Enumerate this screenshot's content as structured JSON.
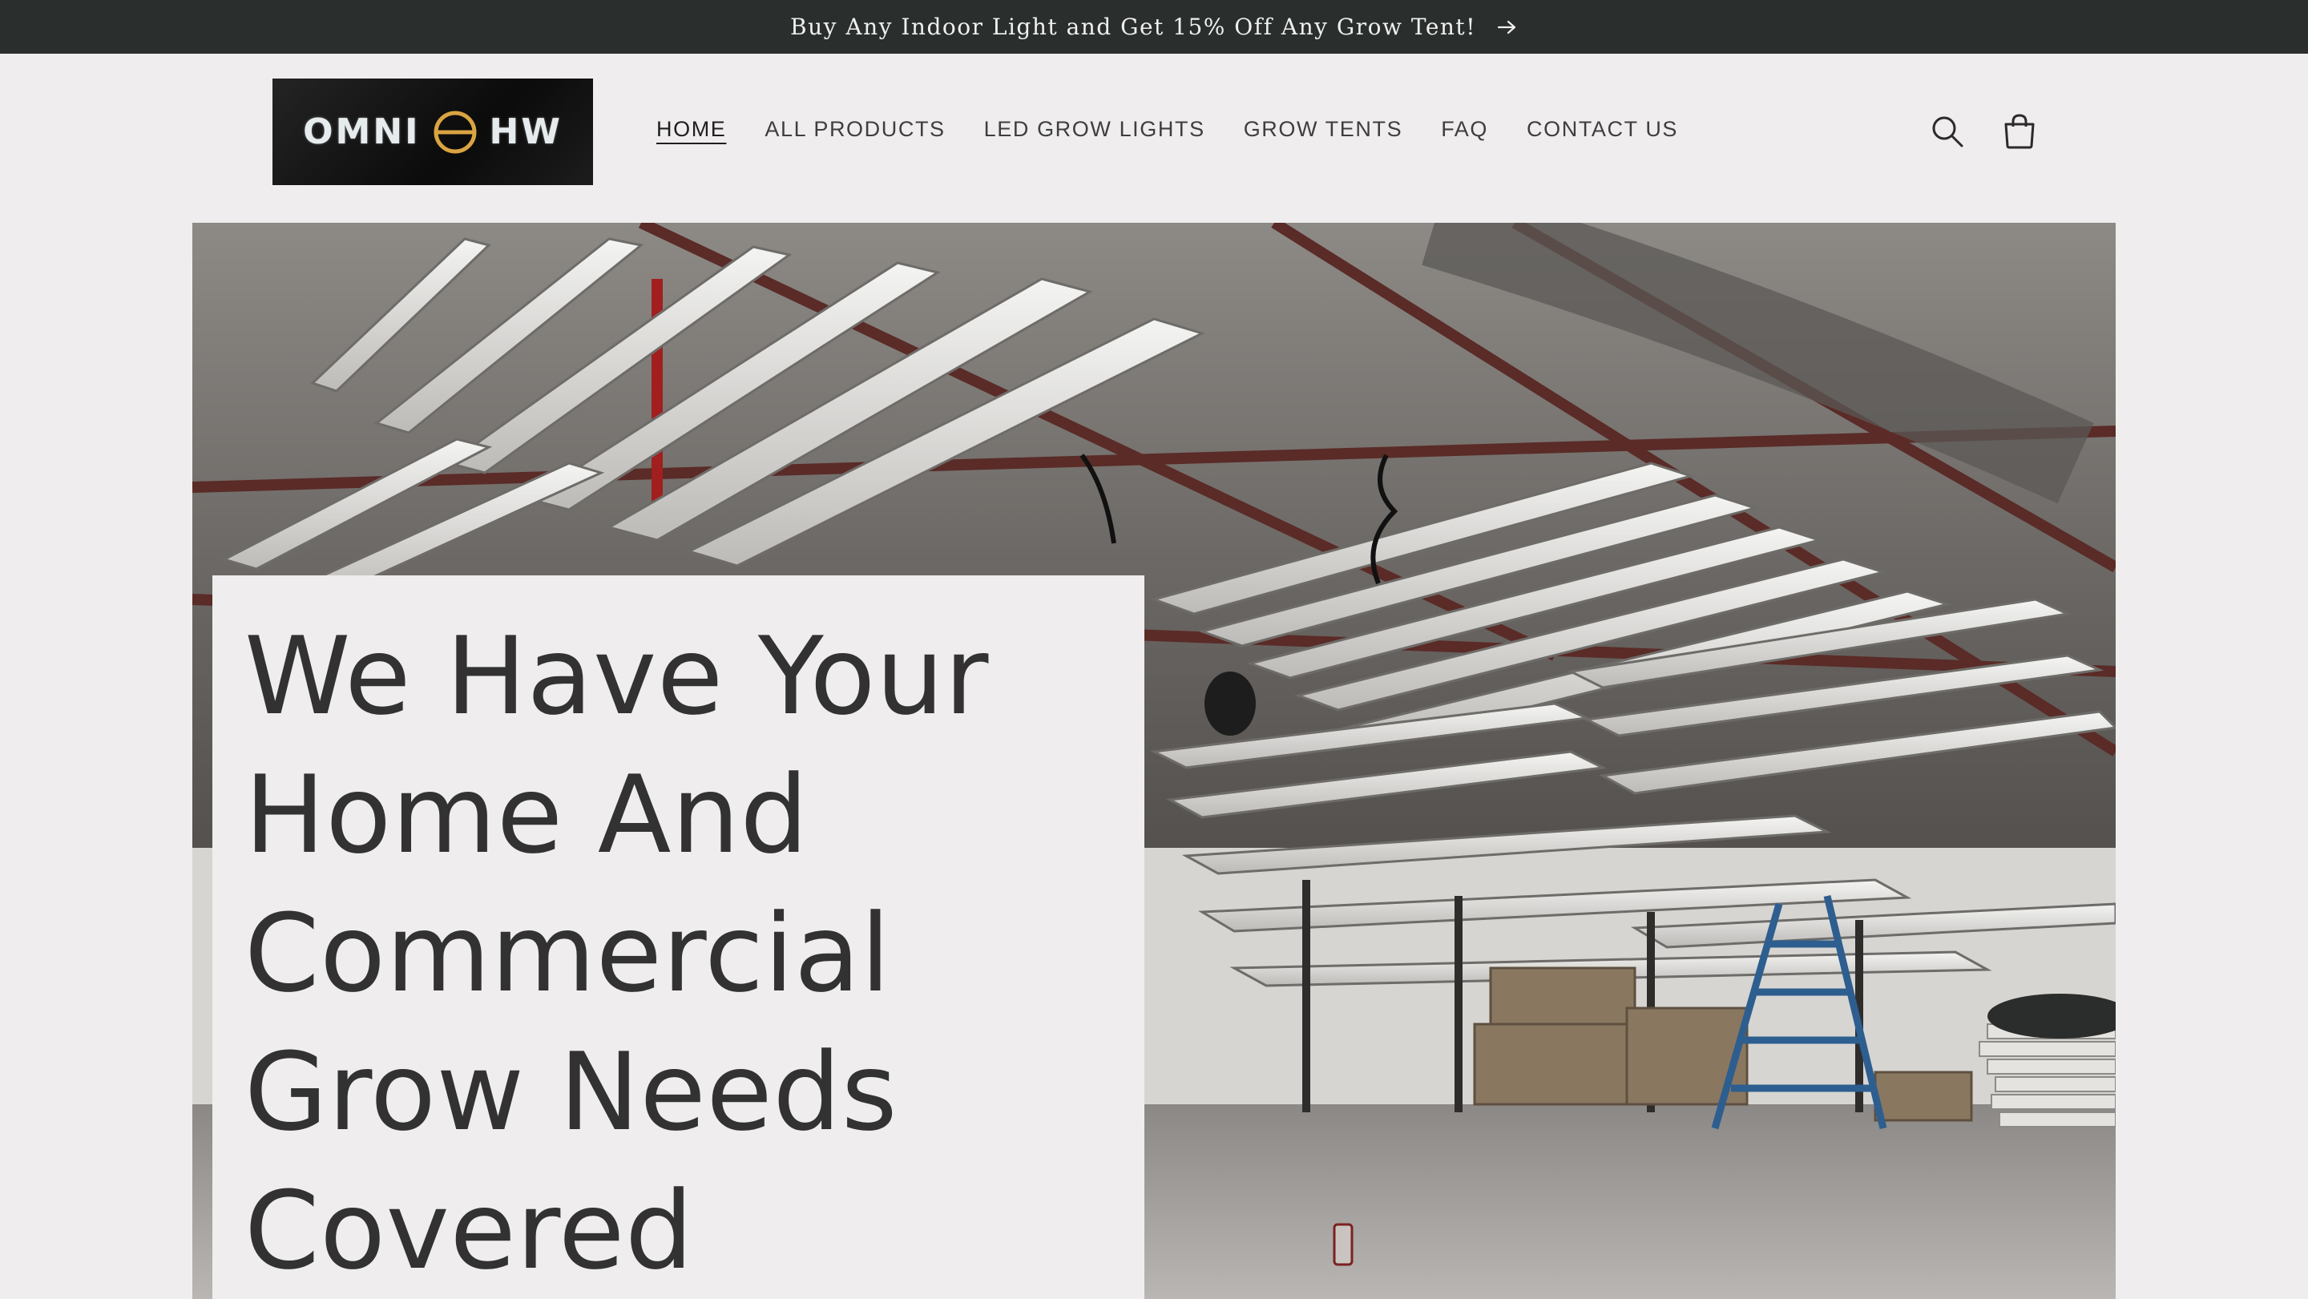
{
  "announcement": {
    "text": "Buy Any Indoor Light and Get 15% Off Any Grow Tent!",
    "icon": "arrow-right-icon"
  },
  "header": {
    "logo_text_left": "OMNI",
    "logo_text_right": "HW",
    "nav": [
      {
        "label": "HOME",
        "active": true
      },
      {
        "label": "ALL PRODUCTS",
        "active": false
      },
      {
        "label": "LED GROW LIGHTS",
        "active": false
      },
      {
        "label": "GROW TENTS",
        "active": false
      },
      {
        "label": "FAQ",
        "active": false
      },
      {
        "label": "CONTACT US",
        "active": false
      }
    ],
    "icons": [
      "search-icon",
      "cart-icon"
    ]
  },
  "hero": {
    "title_lines": [
      "We Have Your",
      "Home And",
      "Commercial",
      "Grow Needs",
      "Covered"
    ]
  },
  "colors": {
    "announcement_bg": "#2a2f2d",
    "page_bg": "#efedee",
    "text": "#333232",
    "logo_accent": "#d9a441"
  }
}
